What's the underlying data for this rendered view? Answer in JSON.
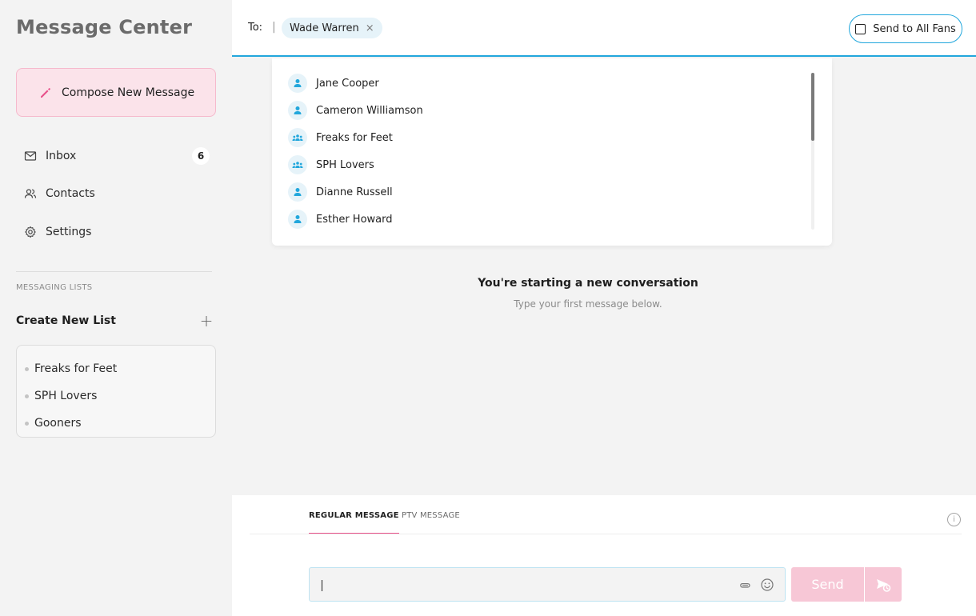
{
  "sidebar": {
    "title": "Message Center",
    "compose_label": "Compose New Message",
    "nav": [
      {
        "label": "Inbox",
        "count": "6",
        "icon": "mail-icon"
      },
      {
        "label": "Contacts",
        "icon": "contacts-icon"
      },
      {
        "label": "Settings",
        "icon": "gear-icon"
      }
    ],
    "section_label": "MESSAGING LISTS",
    "create_list_label": "Create New List",
    "create_list_icon": "+",
    "lists": [
      "Freaks for Feet",
      "SPH Lovers",
      "Gooners"
    ]
  },
  "header": {
    "to_label": "To:",
    "separator": "|",
    "recipient_chip": "Wade Warren",
    "chip_remove": "×",
    "send_all_label": "Send to All Fans"
  },
  "suggestions": [
    {
      "name": "Jane Cooper",
      "type": "person"
    },
    {
      "name": "Cameron Williamson",
      "type": "person"
    },
    {
      "name": "Freaks for Feet",
      "type": "group"
    },
    {
      "name": "SPH Lovers",
      "type": "group"
    },
    {
      "name": "Dianne Russell",
      "type": "person"
    },
    {
      "name": "Esther Howard",
      "type": "person"
    }
  ],
  "conversation": {
    "empty_title": "You're starting a new conversation",
    "empty_subtitle": "Type your first message below."
  },
  "composer": {
    "tabs": [
      "REGULAR MESSAGE",
      "PTV MESSAGE"
    ],
    "active_tab": "REGULAR MESSAGE",
    "input_value": "",
    "send_label": "Send",
    "info_icon": "i"
  },
  "colors": {
    "accent_blue": "#22a7dc",
    "accent_pink": "#e8518a",
    "compose_bg": "#fbe3ea",
    "send_disabled": "#f7c7d6"
  }
}
